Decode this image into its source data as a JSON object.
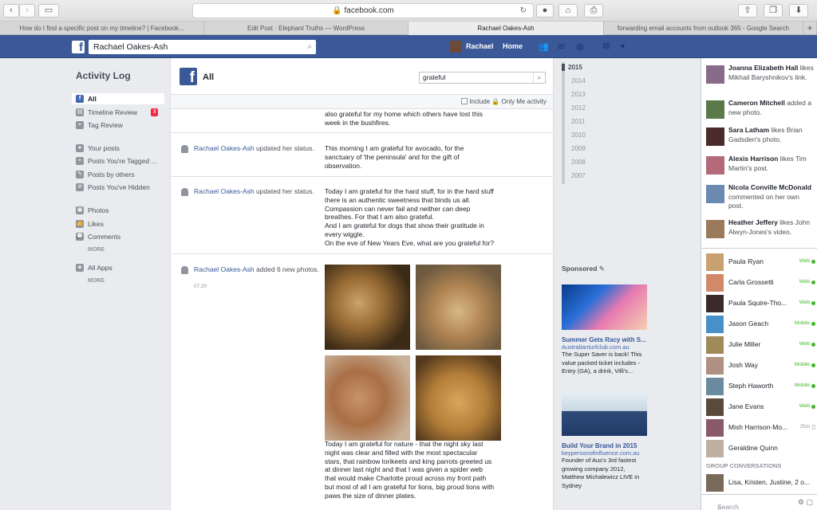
{
  "browser": {
    "url": "facebook.com",
    "tabs": [
      {
        "label": "How do I find a specific post on my timeline? | Facebook...",
        "active": false
      },
      {
        "label": "Edit Post · Elephant Truths — WordPress",
        "active": false
      },
      {
        "label": "Rachael Oakes-Ash",
        "active": true
      },
      {
        "label": "forwarding email accounts from outlook 365 - Google Search",
        "active": false
      }
    ],
    "new_tab": "+"
  },
  "bluebar": {
    "logo": "f",
    "search_value": "Rachael Oakes-Ash",
    "profile_name": "Rachael",
    "home_label": "Home"
  },
  "leftnav": {
    "title": "Activity Log",
    "items": [
      {
        "label": "All",
        "icon": "facebook-icon"
      },
      {
        "label": "Timeline Review",
        "icon": "timeline-icon",
        "badge": "3"
      },
      {
        "label": "Tag Review",
        "icon": "tag-icon"
      },
      {
        "label": "Your posts",
        "icon": "person-icon"
      },
      {
        "label": "Posts You're Tagged ...",
        "icon": "tag-icon"
      },
      {
        "label": "Posts by others",
        "icon": "post-icon"
      },
      {
        "label": "Posts You've Hidden",
        "icon": "hidden-icon"
      },
      {
        "label": "Photos",
        "icon": "photo-icon"
      },
      {
        "label": "Likes",
        "icon": "like-icon"
      },
      {
        "label": "Comments",
        "icon": "comment-icon"
      },
      {
        "label": "All Apps",
        "icon": "apps-icon"
      }
    ],
    "more1": "MORE",
    "more2": "MORE"
  },
  "main": {
    "title": "All",
    "filter_value": "grateful",
    "only_me_label": "Include 🔒 Only Me activity",
    "rows": [
      {
        "content": "also grateful for my home which others have lost this\nweek in the bushfires."
      },
      {
        "actor": "Rachael Oakes-Ash",
        "action": " updated her status.",
        "content": "This morning I am grateful for avocado, for the\nsanctuary of 'the peninsula' and for the gift of\nobservation."
      },
      {
        "actor": "Rachael Oakes-Ash",
        "action": " updated her status.",
        "content": "Today I am grateful for the hard stuff, for in the hard stuff\nthere is an authentic sweetness that binds us all.\nCompassion can never fail and neither can deep\nbreathes. For that I am also grateful.\nAnd I am grateful for dogs that show their gratitude in\nevery wiggle.\nOn the eve of New Years Eve, what are you grateful for?"
      },
      {
        "actor": "Rachael Oakes-Ash",
        "action": " added 6 new photos.",
        "time": "07:20",
        "content": "Today I am grateful for nature - that the night sky last\nnight was clear and filled with the most spectacular\nstars, that rainbow lorikeets and king parrots greeted us\nat dinner last night and that I was given a spider web\nthat would make Charlotte proud across my front path\nbut most of all I am grateful for lions, big proud lions with\npaws the size of dinner plates."
      }
    ]
  },
  "years": [
    "2015",
    "2014",
    "2013",
    "2012",
    "2011",
    "2010",
    "2009",
    "2008",
    "2007"
  ],
  "sponsored": {
    "label": "Sponsored",
    "ads": [
      {
        "title": "Summer Gets Racy with S...",
        "domain": "Australianturfclub.com.au",
        "desc": "The Super Saver is back! This\nvalue packed ticket includes -\nEntry (GA), a drink, Villi's..."
      },
      {
        "title": "Build Your Brand in 2015",
        "domain": "keypersonofinfluence.com.au",
        "desc": "Founder of Aus's 3rd fastest\ngrowing company 2012,\nMatthew Michalewicz LIVE in\nSydney"
      }
    ]
  },
  "ticker": [
    {
      "name": "Joanna Elizabeth Hall",
      "text": " likes Mikhail Baryshnikov's link."
    },
    {
      "name": "Cameron Mitchell",
      "text": " added a new photo."
    },
    {
      "name": "Sara Latham",
      "text": " likes Brian Gadsden's photo."
    },
    {
      "name": "Alexis Harrison",
      "text": " likes Tim Martin's post."
    },
    {
      "name": "Nicola Conville McDonald",
      "text": " commented on her own post."
    },
    {
      "name": "Heather Jeffery",
      "text": " likes John Alwyn-Jones's video."
    }
  ],
  "chat": [
    {
      "name": "Paula Ryan",
      "status": "Web"
    },
    {
      "name": "Carla Grossetti",
      "status": "Web"
    },
    {
      "name": "Paula Squire-Tho...",
      "status": "Web"
    },
    {
      "name": "Jason Geach",
      "status": "Mobile"
    },
    {
      "name": "Julie Miller",
      "status": "Web"
    },
    {
      "name": "Josh Way",
      "status": "Mobile"
    },
    {
      "name": "Steph Haworth",
      "status": "Mobile"
    },
    {
      "name": "Jane Evans",
      "status": "Web"
    },
    {
      "name": "Mish Harrison-Mo...",
      "status": "25m"
    },
    {
      "name": "Geraldine Quinn",
      "status": ""
    }
  ],
  "group_conversations_label": "GROUP CONVERSATIONS",
  "group": {
    "name": "Lisa, Kristen, Justine, 2 o..."
  },
  "chat_search_placeholder": "Search",
  "colors": {
    "fb_blue": "#3b5998",
    "link": "#365899",
    "online": "#42b72a",
    "badge": "#f02849"
  }
}
